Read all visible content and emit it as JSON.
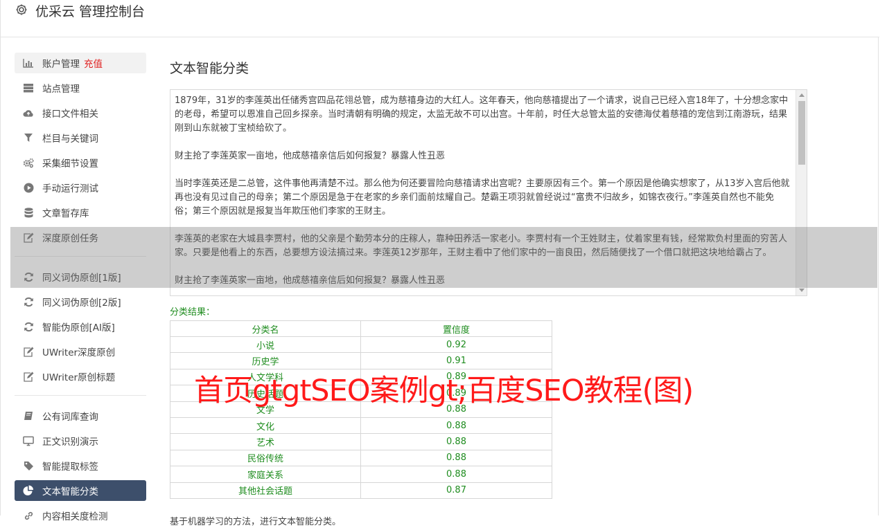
{
  "header": {
    "title": "优采云 管理控制台"
  },
  "sidebar": {
    "groups": [
      [
        {
          "icon": "bar-chart-icon",
          "label": "账户管理",
          "badge": "充值",
          "state": "hover"
        },
        {
          "icon": "server-icon",
          "label": "站点管理"
        },
        {
          "icon": "cloud-upload-icon",
          "label": "接口文件相关"
        },
        {
          "icon": "filter-icon",
          "label": "栏目与关键词"
        },
        {
          "icon": "gears-icon",
          "label": "采集细节设置"
        },
        {
          "icon": "play-circle-icon",
          "label": "手动运行测试"
        },
        {
          "icon": "database-icon",
          "label": "文章暂存库"
        },
        {
          "icon": "edit-icon",
          "label": "深度原创任务"
        }
      ],
      [
        {
          "icon": "refresh-icon",
          "label": "同义词伪原创[1版]"
        },
        {
          "icon": "refresh-icon",
          "label": "同义词伪原创[2版]"
        },
        {
          "icon": "refresh-icon",
          "label": "智能伪原创[AI版]"
        },
        {
          "icon": "edit-icon",
          "label": "UWriter深度原创"
        },
        {
          "icon": "edit-icon",
          "label": "UWriter原创标题"
        }
      ],
      [
        {
          "icon": "book-icon",
          "label": "公有词库查询"
        },
        {
          "icon": "monitor-icon",
          "label": "正文识别演示"
        },
        {
          "icon": "tag-icon",
          "label": "智能提取标签"
        },
        {
          "icon": "pie-chart-icon",
          "label": "文本智能分类",
          "state": "active"
        },
        {
          "icon": "link-icon",
          "label": "内容相关度检测"
        }
      ]
    ]
  },
  "main": {
    "title": "文本智能分类",
    "input_text": "1879年，31岁的李莲英出任储秀宫四品花翎总管，成为慈禧身边的大红人。这年春天，他向慈禧提出了一个请求，说自己已经入宫18年了，十分想念家中的老母，希望可以恩准自己回乡探亲。当时清朝有明确的规定，太监无故不可以出宫。十年前，时任大总管太监的安德海仗着慈禧的宠信到江南游玩，结果刚到山东就被丁宝桢给砍了。\n\n财主抢了李莲英家一亩地，他成慈禧亲信后如何报复？暴露人性丑恶\n\n当时李莲英还是二总管，这件事他再清楚不过。那么他为何还要冒险向慈禧请求出宫呢？主要原因有三个。第一个原因是他确实想家了，从13岁入宫后他就再也没有见过自己的母亲；第二个原因是急于在老家的乡亲们面前炫耀自己。楚霸王项羽就曾经说过“富贵不归故乡，如锦衣夜行。”李莲英自然也不能免俗；第三个原因就是报复当年欺压他们李家的王财主。\n\n李莲英的老家在大城县李贾村，他的父亲是个勤劳本分的庄稼人，靠种田养活一家老小。李贾村有一个王姓财主，仗着家里有钱，经常欺负村里面的穷苦人家。只要是他看上的东西，总要想方设法搞过来。李莲英12岁那年，王财主看中了他们家中的一亩良田，然后随便找了一个借口就把这块地给霸占了。\n\n财主抢了李莲英家一亩地，他成慈禧亲信后如何报复？暴露人性丑恶",
    "result_label": "分类结果：",
    "table": {
      "headers": [
        "分类名",
        "置信度"
      ],
      "rows": [
        [
          "小说",
          "0.92"
        ],
        [
          "历史学",
          "0.91"
        ],
        [
          "人文学科",
          "0.89"
        ],
        [
          "历史话题",
          "0.89"
        ],
        [
          "文学",
          "0.88"
        ],
        [
          "文化",
          "0.88"
        ],
        [
          "艺术",
          "0.88"
        ],
        [
          "民俗传统",
          "0.88"
        ],
        [
          "家庭关系",
          "0.88"
        ],
        [
          "其他社会话题",
          "0.87"
        ]
      ]
    },
    "footnote": "基于机器学习的方法，进行文本智能分类。"
  },
  "watermark": "首页gtgtSEO案例gt;百度SEO教程(图)"
}
